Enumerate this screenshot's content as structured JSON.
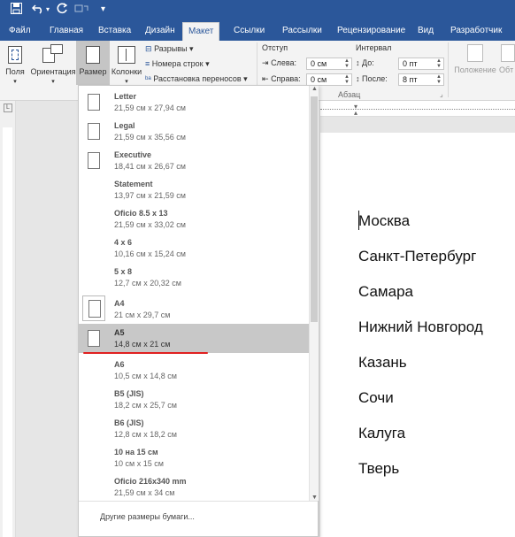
{
  "window": {
    "accent_color": "#2b579a",
    "quick_access": [
      "save-icon",
      "undo-icon",
      "redo-icon",
      "customize-icon"
    ]
  },
  "ribbon_tabs": [
    {
      "label": "Файл"
    },
    {
      "label": "Главная"
    },
    {
      "label": "Вставка"
    },
    {
      "label": "Дизайн"
    },
    {
      "label": "Макет",
      "active": true
    },
    {
      "label": "Ссылки"
    },
    {
      "label": "Рассылки"
    },
    {
      "label": "Рецензирование"
    },
    {
      "label": "Вид"
    },
    {
      "label": "Разработчик"
    }
  ],
  "ribbon": {
    "margins_label": "Поля",
    "orientation_label": "Ориентация",
    "size_label": "Размер",
    "columns_label": "Колонки",
    "breaks_label": "Разрывы",
    "line_numbers_label": "Номера строк",
    "hyphenation_label": "Расстановка переносов",
    "indent_title": "Отступ",
    "left_label": "Слева:",
    "left_value": "0 см",
    "right_label": "Справа:",
    "right_value": "0 см",
    "spacing_title": "Интервал",
    "before_label": "До:",
    "before_value": "0 пт",
    "after_label": "После:",
    "after_value": "8 пт",
    "paragraph_group": "Абзац",
    "position_label": "Положение",
    "wrap_label": "Обт"
  },
  "size_menu": {
    "items": [
      {
        "name": "Letter",
        "dims": "21,59 см x 27,94 см"
      },
      {
        "name": "Legal",
        "dims": "21,59 см x 35,56 см"
      },
      {
        "name": "Executive",
        "dims": "18,41 см x 26,67 см"
      },
      {
        "name": "Statement",
        "dims": "13,97 см x 21,59 см"
      },
      {
        "name": "Oficio 8.5 x 13",
        "dims": "21,59 см x 33,02 см"
      },
      {
        "name": "4 x 6",
        "dims": "10,16 см x 15,24 см"
      },
      {
        "name": "5 x 8",
        "dims": "12,7 см x 20,32 см"
      },
      {
        "name": "A4",
        "dims": "21 см x 29,7 см"
      },
      {
        "name": "A5",
        "dims": "14,8 см x 21 см"
      },
      {
        "name": "A6",
        "dims": "10,5 см x 14,8 см"
      },
      {
        "name": "B5 (JIS)",
        "dims": "18,2 см x 25,7 см"
      },
      {
        "name": "B6 (JIS)",
        "dims": "12,8 см x 18,2 см"
      },
      {
        "name": "10 на 15 см",
        "dims": "10 см x 15 см"
      },
      {
        "name": "Oficio 216x340 mm",
        "dims": "21,59 см x 34 см"
      }
    ],
    "selected": "A5",
    "current": "A4",
    "more_label": "Другие размеры бумаги..."
  },
  "document": {
    "cities": [
      "Москва",
      "Санкт-Петербург",
      "Самара",
      "Нижний Новгород",
      "Казань",
      "Сочи",
      "Калуга",
      "Тверь"
    ]
  }
}
